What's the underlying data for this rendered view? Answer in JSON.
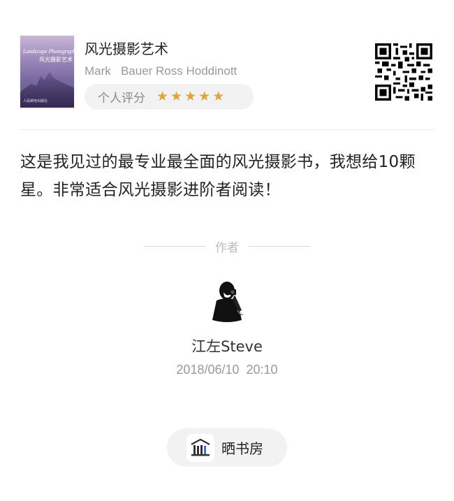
{
  "book": {
    "title": "风光摄影艺术",
    "authors": "Mark   Bauer Ross Hoddinott",
    "cover": {
      "title_en": "Landscape Photography",
      "title_cn": "风光摄影艺术",
      "publisher_note": "人民邮电出版社"
    },
    "rating": {
      "label": "个人评分",
      "stars": 5,
      "star_color": "#e0a33d"
    }
  },
  "review": {
    "text": "这是我见过的最专业最全面的风光摄影书，我想给10颗星。非常适合风光摄影进阶者阅读！"
  },
  "author": {
    "heading": "作者",
    "name": "江左Steve",
    "date": "2018/06/10  20:10"
  },
  "share": {
    "label": "晒书房",
    "icon": "bookshelf-icon"
  },
  "qr": {
    "icon": "qr-code-icon"
  }
}
